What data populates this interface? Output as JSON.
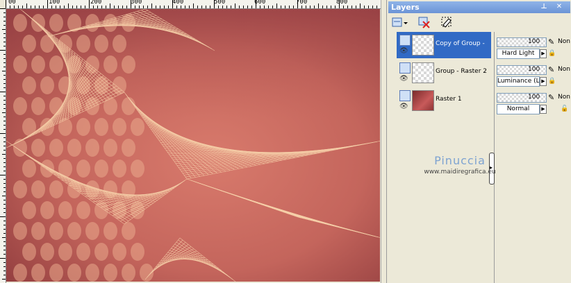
{
  "ruler": {
    "labels": [
      "00",
      "100",
      "200",
      "300",
      "400",
      "500",
      "600",
      "700",
      "800"
    ]
  },
  "layers_panel": {
    "title": "Layers",
    "pin_glyph": "⊥",
    "close_glyph": "✕",
    "layers": [
      {
        "name": "Copy of Group -",
        "selected": true,
        "thumbnail": "transparent-checker",
        "opacity": "100",
        "blend": "Hard Light",
        "extra": "Non"
      },
      {
        "name": "Group - Raster 2",
        "selected": false,
        "thumbnail": "transparent-checker",
        "opacity": "100",
        "blend": "Luminance (L)",
        "extra": "Non"
      },
      {
        "name": "Raster 1",
        "selected": false,
        "thumbnail": "dark-red-raster",
        "opacity": "100",
        "blend": "Normal",
        "extra": "Non"
      }
    ],
    "watermark": {
      "name": "Pinuccia",
      "url": "www.maidiregrafica.eu"
    },
    "colors": {
      "title_bar": "#7aa0e0",
      "selected_row": "#316ac5",
      "canvas_base": "#c86a62"
    }
  }
}
